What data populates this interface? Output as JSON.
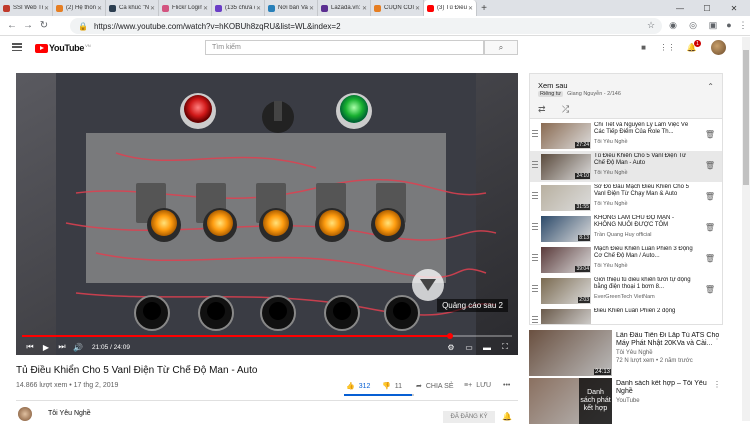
{
  "browser": {
    "tabs": [
      {
        "title": "SSI Web Trading",
        "color": "#c0392b",
        "active": false
      },
      {
        "title": "(2) Hệ thống tỉ",
        "color": "#e67e22",
        "active": false
      },
      {
        "title": "Ca khúc \"Nửa",
        "color": "#2c3e50",
        "active": false
      },
      {
        "title": "Flickr Login",
        "color": "#d35480",
        "active": false
      },
      {
        "title": "(135 chưa đọ",
        "color": "#6a3dc6",
        "active": false
      },
      {
        "title": "Nơi bán Van Đ",
        "color": "#2980b9",
        "active": false
      },
      {
        "title": "Lazada.vn: Onl",
        "color": "#5b2e91",
        "active": false
      },
      {
        "title": "CUỘN COIL D",
        "color": "#e67e22",
        "active": false
      },
      {
        "title": "(3) Tủ Điều Kh",
        "color": "#ff0000",
        "active": true
      }
    ],
    "new_tab": "+",
    "url": "https://www.youtube.com/watch?v=hKOBUh8zqRU&list=WL&index=2",
    "controls": {
      "minimize": "—",
      "maximize": "☐",
      "close": "✕"
    }
  },
  "youtube": {
    "logo_text": "YouTube",
    "logo_country": "VN",
    "search_placeholder": "Tìm kiếm",
    "notification_count": "1"
  },
  "player": {
    "current_time": "21:05",
    "duration": "24:09",
    "time_display": "21:05 / 24:09",
    "progress": 0.873,
    "ad_label": "Quảng cáo sau 2"
  },
  "video": {
    "title": "Tủ Điều Khiển Cho 5 Vanl Điện Từ Chế Độ Man - Auto",
    "views": "14.866 lượt xem",
    "date": "17 thg 2, 2019",
    "meta": "14.866 lượt xem • 17 thg 2, 2019",
    "likes": "312",
    "dislikes": "11",
    "like_ratio": 0.966,
    "share_label": "CHIA SẺ",
    "save_label": "LƯU",
    "channel": "Tôi Yêu Nghề",
    "subscribe_label": "ĐÃ ĐĂNG KÝ"
  },
  "playlist": {
    "title": "Xem sau",
    "privacy": "Riêng tư",
    "owner_progress": "Giang Nguyễn - 2/146",
    "items": [
      {
        "title": "Chi Tiết và Nguyên Lý Làm Việc Về Các Tiếp Điểm Của Role Th...",
        "channel": "Tôi Yêu Nghề",
        "duration": "27:24",
        "current": false,
        "thumb": "#8a6b52"
      },
      {
        "title": "Tủ Điều Khiển Cho 5 Vanl Điện Từ Chế Độ Man - Auto",
        "channel": "Tôi Yêu Nghề",
        "duration": "24:10",
        "current": true,
        "thumb": "#5a4a3c"
      },
      {
        "title": "Sơ Đồ Đấu Mạch Điều Khiển Cho 5 Vanl Điện Từ Chạy Man & Auto",
        "channel": "Tôi Yêu Nghề",
        "duration": "31:55",
        "current": false,
        "thumb": "#b8b0a0"
      },
      {
        "title": "KHÔNG LÀM CHỦ ĐỘ MẠN - KHÔNG NUÔI ĐƯỢC TÔM",
        "channel": "Trần Quang Huy official",
        "duration": "8:13",
        "current": false,
        "thumb": "#2c4a6a"
      },
      {
        "title": "Mạch Điều Khiển Luân Phiên 3 Động Cơ Chế Độ Man / Auto...",
        "channel": "Tôi Yêu Nghề",
        "duration": "39:04",
        "current": false,
        "thumb": "#5a3a3a"
      },
      {
        "title": "Giới thiệu tủ điều khiển tưới tự động bằng điện thoại 1 bơm 8...",
        "channel": "EverGreenTech VietNam",
        "duration": "2:03",
        "current": false,
        "thumb": "#7a6a50"
      },
      {
        "title": "Điều Khiển Luân Phiên 2 động",
        "channel": "",
        "duration": "",
        "current": false,
        "thumb": "#6a5a4a"
      }
    ]
  },
  "recommendations": [
    {
      "title": "Lần Đầu Tiên Đi Lắp Tủ ATS Cho Máy Phát Nhật 20KVa và Cài...",
      "channel": "Tôi Yêu Nghề",
      "views": "72 N lượt xem • 2 năm trước",
      "duration": "24:13",
      "thumb": "#6a5040"
    },
    {
      "title": "Danh sách kết hợp – Tôi Yêu Nghề",
      "channel": "YouTube",
      "mix_label": "Danh sách phát kết hợp",
      "thumb": "#8a7060"
    }
  ],
  "colors": {
    "youtube_red": "#ff0000",
    "like_blue": "#065fd4",
    "current_row": "#e8e8e8"
  }
}
